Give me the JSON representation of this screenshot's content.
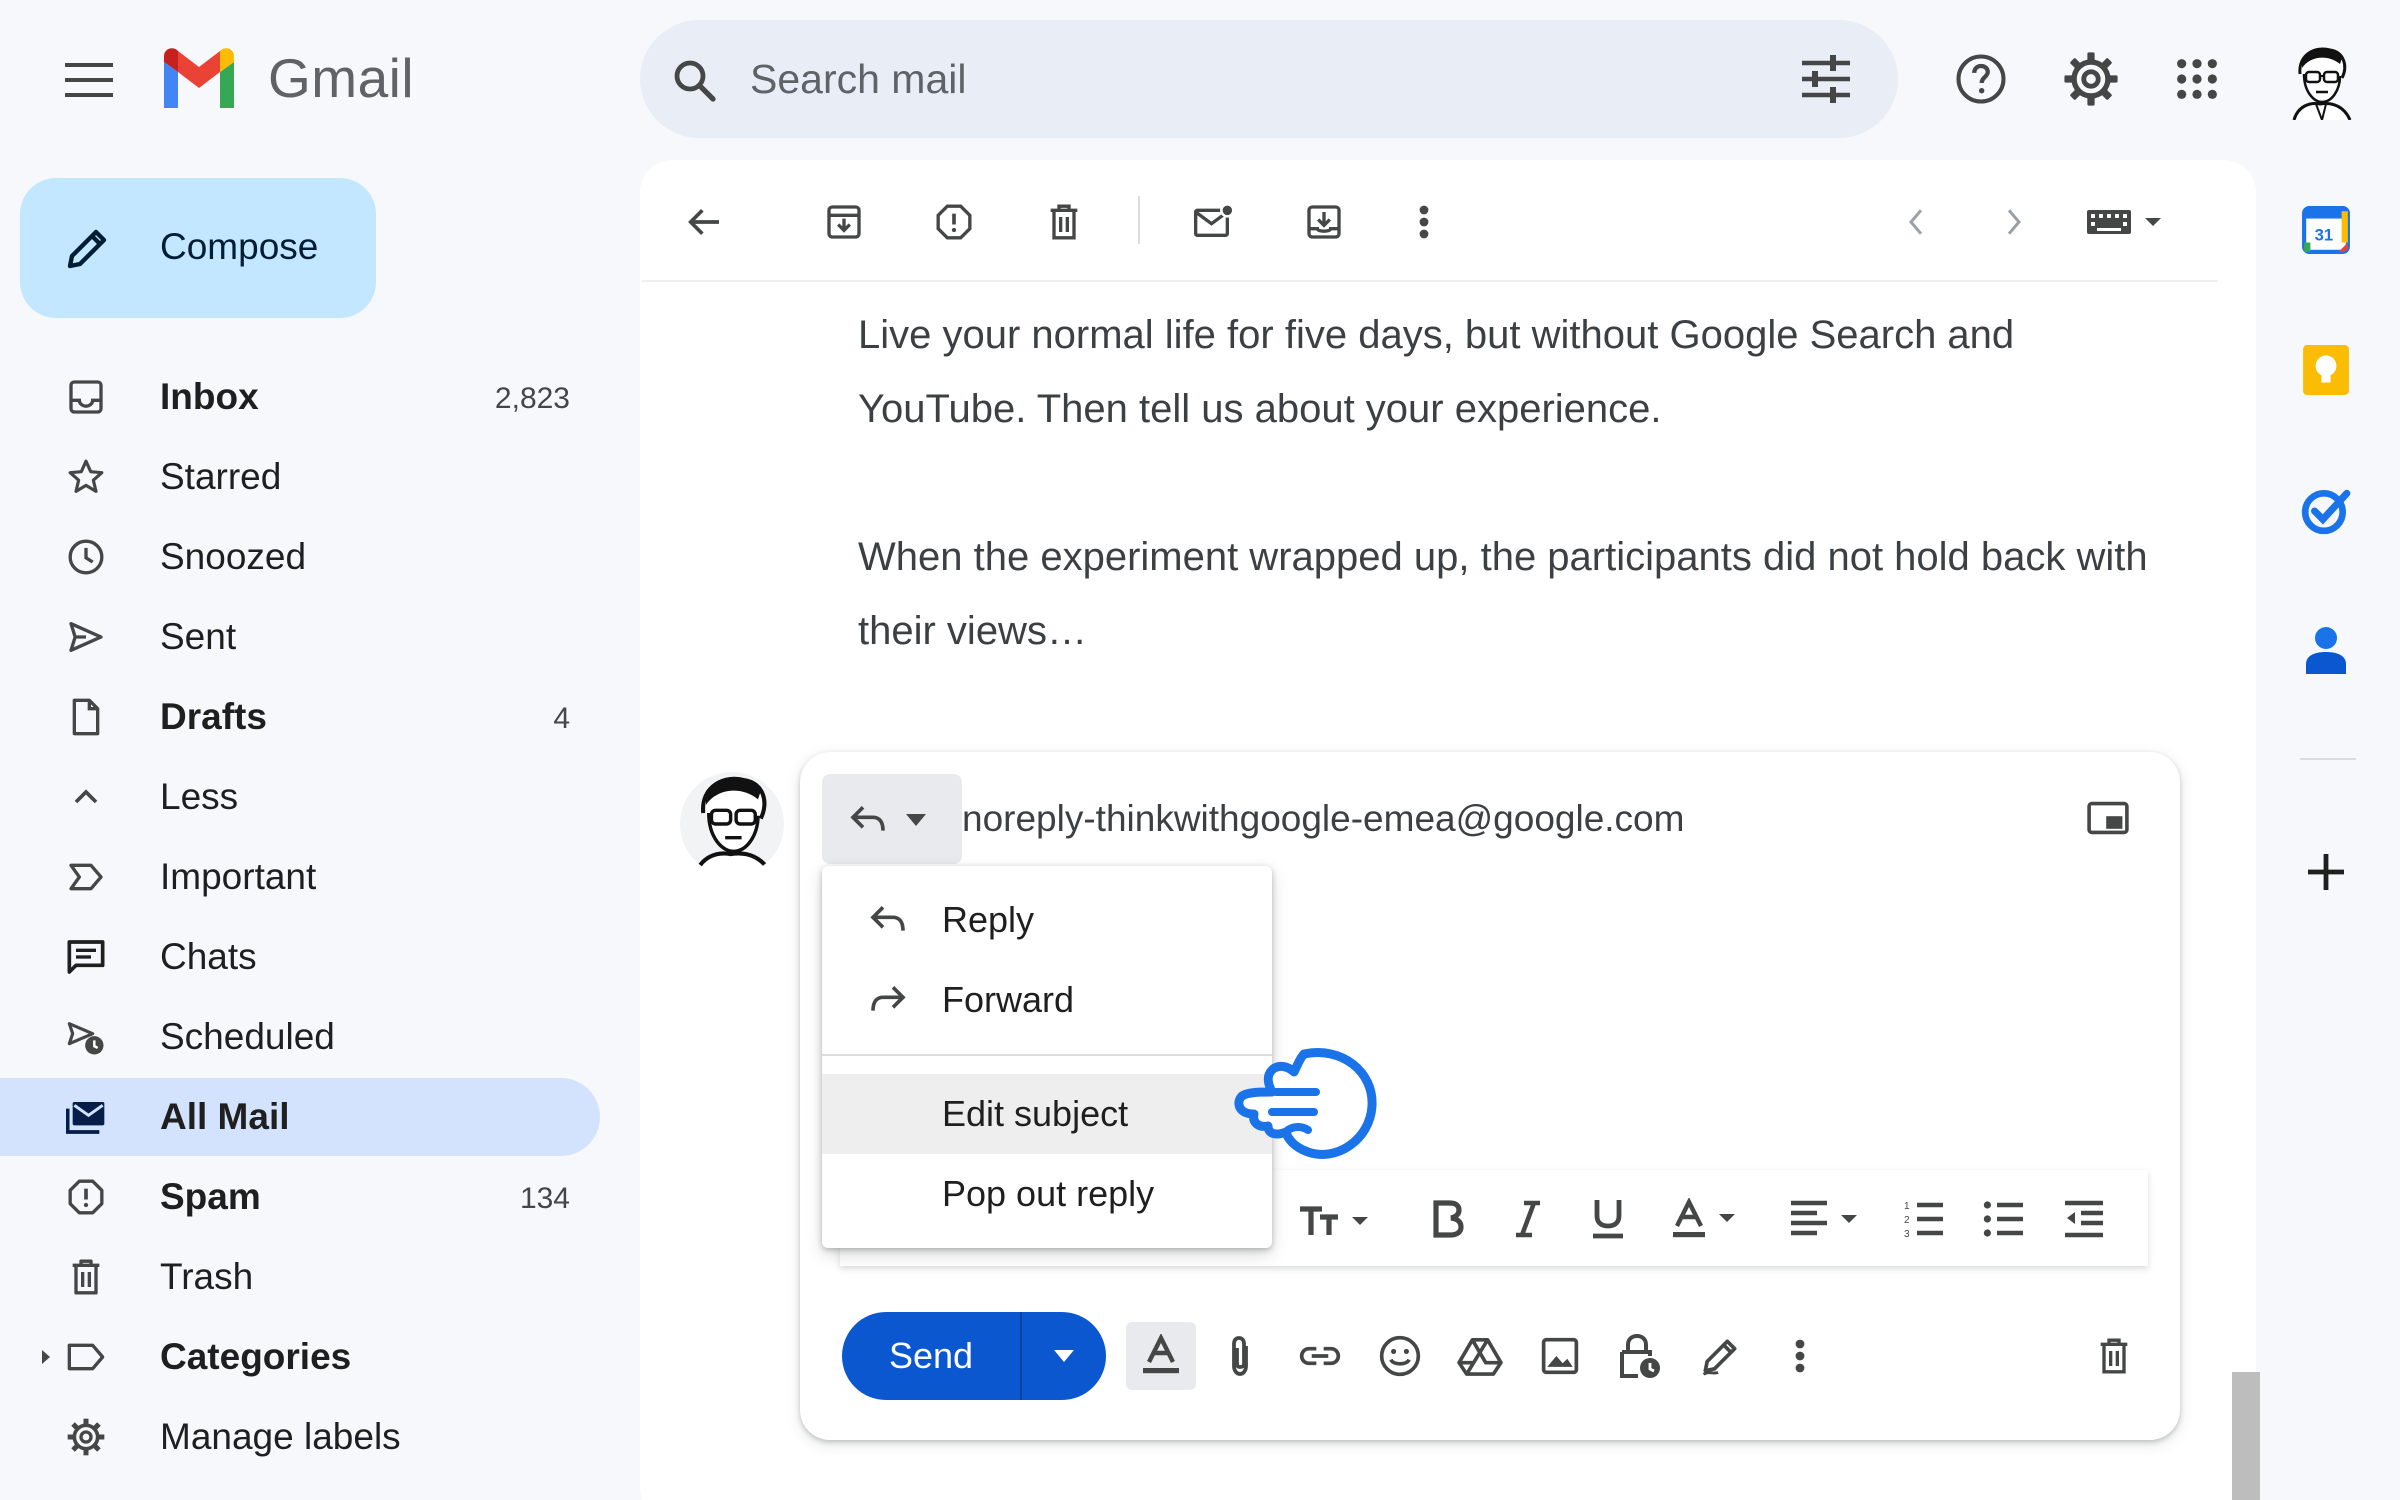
{
  "app": {
    "name": "Gmail",
    "brand_colors": [
      "#4285f4",
      "#ea4335",
      "#fbbc04",
      "#34a853"
    ],
    "accent": "#0b57d0"
  },
  "search": {
    "placeholder": "Search mail"
  },
  "compose": {
    "label": "Compose"
  },
  "sidebar": {
    "items": [
      {
        "label": "Inbox",
        "count": "2,823",
        "icon": "inbox-icon",
        "bold": true
      },
      {
        "label": "Starred",
        "count": "",
        "icon": "star-icon",
        "bold": false
      },
      {
        "label": "Snoozed",
        "count": "",
        "icon": "clock-icon",
        "bold": false
      },
      {
        "label": "Sent",
        "count": "",
        "icon": "send-icon",
        "bold": false
      },
      {
        "label": "Drafts",
        "count": "4",
        "icon": "draft-icon",
        "bold": true
      },
      {
        "label": "Less",
        "count": "",
        "icon": "chevron-up-icon",
        "bold": false
      },
      {
        "label": "Important",
        "count": "",
        "icon": "important-icon",
        "bold": false
      },
      {
        "label": "Chats",
        "count": "",
        "icon": "chat-icon",
        "bold": false
      },
      {
        "label": "Scheduled",
        "count": "",
        "icon": "scheduled-send-icon",
        "bold": false
      },
      {
        "label": "All Mail",
        "count": "",
        "icon": "all-mail-icon",
        "bold": true,
        "active": true
      },
      {
        "label": "Spam",
        "count": "134",
        "icon": "spam-icon",
        "bold": true
      },
      {
        "label": "Trash",
        "count": "",
        "icon": "trash-icon",
        "bold": false
      },
      {
        "label": "Categories",
        "count": "",
        "icon": "label-icon",
        "bold": true
      },
      {
        "label": "Manage labels",
        "count": "",
        "icon": "gear-icon",
        "bold": false
      }
    ]
  },
  "message": {
    "paragraph1": "Live your normal life for five days, but without Google Search and YouTube. Then tell us about your experience.",
    "paragraph2": "When the experiment wrapped up, the participants did not hold back with their views…"
  },
  "reply": {
    "recipient": "noreply-thinkwithgoogle-emea@google.com",
    "send_label": "Send",
    "menu": [
      {
        "label": "Reply",
        "icon": "reply-icon"
      },
      {
        "label": "Forward",
        "icon": "forward-icon"
      },
      {
        "label": "Edit subject",
        "icon": ""
      },
      {
        "label": "Pop out reply",
        "icon": ""
      }
    ]
  },
  "right_rail": {
    "apps": [
      "calendar-icon",
      "keep-icon",
      "tasks-icon",
      "contacts-icon",
      "add-icon"
    ],
    "calendar_date": "31"
  }
}
